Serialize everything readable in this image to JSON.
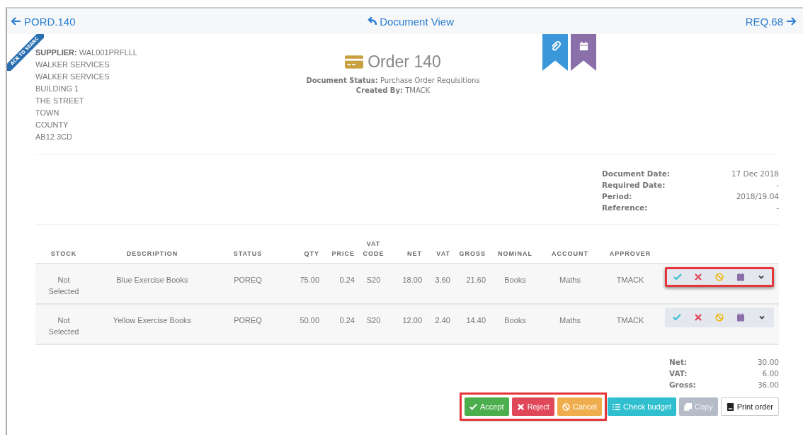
{
  "nav": {
    "prev": "PORD.140",
    "title": "Document View",
    "next": "REQ.68"
  },
  "ribbon": "ACK TO SEARC",
  "supplier": {
    "label": "SUPPLIER:",
    "code": "WAL001PRFLLL",
    "address": [
      "WALKER SERVICES",
      "WALKER SERVICES",
      "BUILDING 1",
      "THE STREET",
      "TOWN",
      "COUNTY",
      "AB12 3CD"
    ]
  },
  "order": {
    "title": "Order 140",
    "status_label": "Document Status:",
    "status": "Purchase Order Requisitions",
    "created_label": "Created By:",
    "created": "TMACK"
  },
  "bookmarks": [
    {
      "kind": "attachment",
      "color": "#3a97d9"
    },
    {
      "kind": "calendar",
      "color": "#8a6fa8"
    }
  ],
  "dates": [
    {
      "label": "Document Date:",
      "value": "17 Dec 2018"
    },
    {
      "label": "Required Date:",
      "value": "-"
    },
    {
      "label": "Period:",
      "value": "2018/19.04"
    },
    {
      "label": "Reference:",
      "value": "-"
    }
  ],
  "table": {
    "columns": [
      "STOCK",
      "DESCRIPTION",
      "STATUS",
      "QTY",
      "PRICE",
      "VAT CODE",
      "NET",
      "VAT",
      "GROSS",
      "NOMINAL",
      "ACCOUNT",
      "APPROVER"
    ],
    "rows": [
      {
        "cells": [
          "Not Selected",
          "Blue Exercise Books",
          "POREQ",
          "75.00",
          "0.24",
          "S20",
          "18.00",
          "3.60",
          "21.60",
          "Books",
          "Maths",
          "TMACK"
        ],
        "highlighted": true
      },
      {
        "cells": [
          "Not Selected",
          "Yellow Exercise Books",
          "POREQ",
          "50.00",
          "0.24",
          "S20",
          "12.00",
          "2.40",
          "14.40",
          "Books",
          "Maths",
          "TMACK"
        ],
        "highlighted": false
      }
    ]
  },
  "totals": [
    {
      "label": "Net:",
      "value": "30.00"
    },
    {
      "label": "VAT:",
      "value": "6.00"
    },
    {
      "label": "Gross:",
      "value": "36.00"
    }
  ],
  "buttons": {
    "primary_highlighted": true,
    "primary": [
      {
        "label": "Accept",
        "kind": "accept",
        "disabled": false
      },
      {
        "label": "Reject",
        "kind": "reject",
        "disabled": false
      },
      {
        "label": "Cancel",
        "kind": "cancel",
        "disabled": false
      }
    ],
    "secondary": [
      {
        "label": "Check budget",
        "kind": "budget",
        "disabled": false
      },
      {
        "label": "Copy",
        "kind": "copy",
        "disabled": true
      },
      {
        "label": "Print order",
        "kind": "print",
        "disabled": false
      }
    ]
  }
}
